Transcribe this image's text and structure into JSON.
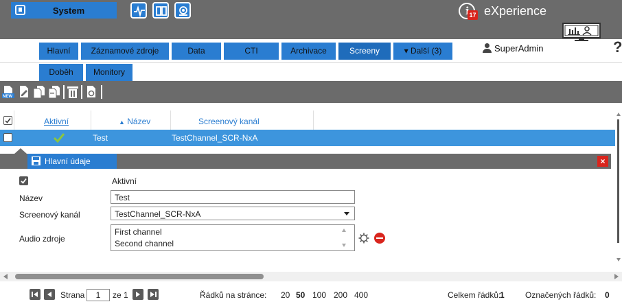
{
  "header": {
    "system_label": "System",
    "brand_name": "eXperience",
    "notifications_count": "17",
    "help_glyph": "?"
  },
  "nav": {
    "tabs_row1": [
      {
        "label": "Hlavní",
        "active": false
      },
      {
        "label": "Záznamové zdroje",
        "active": false
      },
      {
        "label": "Data",
        "active": false
      },
      {
        "label": "CTI",
        "active": false
      },
      {
        "label": "Archivace",
        "active": false
      },
      {
        "label": "Screeny",
        "active": true
      },
      {
        "label": "▾ Další (3)",
        "active": false
      }
    ],
    "tabs_row2": [
      {
        "label": "Doběh",
        "active": false
      },
      {
        "label": "Monitory",
        "active": false
      }
    ],
    "user": "SuperAdmin"
  },
  "grid": {
    "columns": [
      "Aktivní",
      "Název",
      "Screenový kanál"
    ],
    "sort_indicator": "▲",
    "rows": [
      {
        "active": true,
        "name": "Test",
        "channel": "TestChannel_SCR-NxA",
        "selected": true
      }
    ]
  },
  "detail": {
    "tab_label": "Hlavní údaje",
    "close_glyph": "×",
    "fields": {
      "active_label": "Aktivní",
      "name_label": "Název",
      "name_value": "Test",
      "channel_label": "Screenový kanál",
      "channel_value": "TestChannel_SCR-NxA",
      "audio_label": "Audio zdroje",
      "audio_items": [
        "First channel",
        "Second channel"
      ]
    }
  },
  "pager": {
    "page_label": "Strana",
    "page_value": "1",
    "of_label": "ze 1",
    "rows_per_page_label": "Řádků na stránce:",
    "rows_options": [
      "20",
      "50",
      "100",
      "200",
      "400"
    ],
    "rows_selected": "50",
    "total_label": "Celkem řádků:",
    "total_value": "1",
    "selected_label": "Označených řádků:",
    "selected_value": "0"
  },
  "colors": {
    "accent": "#2a7dd1",
    "selected_row": "#3d95dd",
    "toolbar": "#6b6b6b",
    "danger": "#d9251d",
    "check": "#8cc63f"
  }
}
